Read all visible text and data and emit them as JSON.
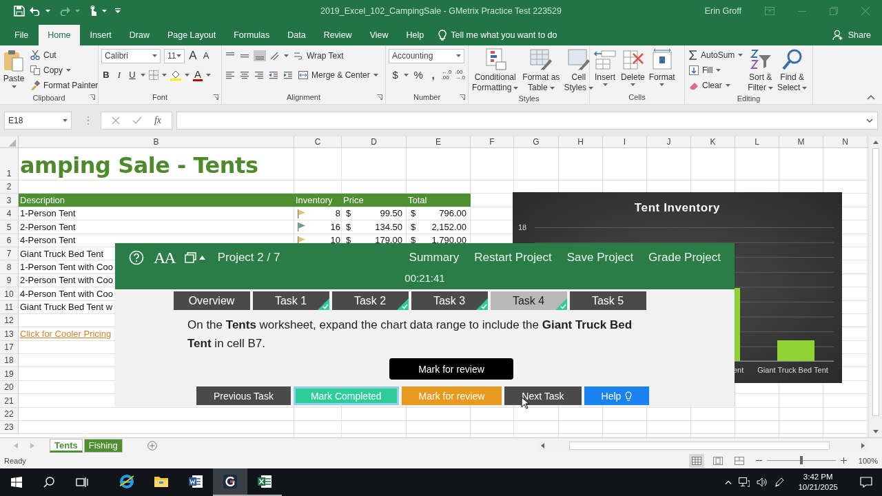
{
  "title_bar": {
    "title": "2019_Excel_102_CampingSale  -  GMetrix Practice Test 223529",
    "user": "Erin Groff"
  },
  "ribbon_tabs": [
    {
      "label": "File",
      "selected": false
    },
    {
      "label": "Home",
      "selected": true
    },
    {
      "label": "Insert",
      "selected": false
    },
    {
      "label": "Draw",
      "selected": false
    },
    {
      "label": "Page Layout",
      "selected": false
    },
    {
      "label": "Formulas",
      "selected": false
    },
    {
      "label": "Data",
      "selected": false
    },
    {
      "label": "Review",
      "selected": false
    },
    {
      "label": "View",
      "selected": false
    },
    {
      "label": "Help",
      "selected": false
    }
  ],
  "tell_me": "Tell me what you want to do",
  "share": "Share",
  "ribbon": {
    "clipboard": {
      "label": "Clipboard",
      "paste": "Paste",
      "cut": "Cut",
      "copy": "Copy",
      "format_painter": "Format Painter"
    },
    "font": {
      "label": "Font",
      "font_name": "Calibri",
      "font_size": "11",
      "grow": "A",
      "shrink": "A",
      "bold": "B",
      "italic": "I",
      "underline": "U",
      "font_color": "A"
    },
    "alignment": {
      "label": "Alignment",
      "wrap_text": "Wrap Text",
      "merge_center": "Merge & Center"
    },
    "number": {
      "label": "Number",
      "format": "Accounting",
      "currency": "$",
      "percent": "%",
      "comma": ",",
      "increase_decimal": "←.0\n.00",
      "decrease_decimal": ".00\n→.0"
    },
    "styles": {
      "label": "Styles",
      "buttons": [
        "Conditional\nFormatting",
        "Format as\nTable",
        "Cell\nStyles"
      ]
    },
    "cells": {
      "label": "Cells",
      "buttons": [
        "Insert",
        "Delete",
        "Format"
      ]
    },
    "editing": {
      "label": "Editing",
      "autosum": "AutoSum",
      "fill": "Fill",
      "clear": "Clear",
      "sort_filter": "Sort &\nFilter",
      "find_select": "Find &\nSelect"
    }
  },
  "formula_bar": {
    "name_box": "E18",
    "function_label": "fx"
  },
  "sheet": {
    "columns": [
      "B",
      "C",
      "D",
      "E",
      "F",
      "G",
      "H",
      "I",
      "J",
      "K",
      "L",
      "M",
      "N"
    ],
    "rows": [
      {
        "number": "1",
        "kind": "title",
        "description": "amping Sale - Tents"
      },
      {
        "number": "2",
        "kind": "empty"
      },
      {
        "number": "3",
        "kind": "header",
        "labels": [
          "Description",
          "Inventory",
          "Price",
          "Total"
        ]
      },
      {
        "number": "4",
        "kind": "item",
        "description": "1-Person Tent",
        "color": "#e3c069",
        "inventory": "8",
        "price_currency": "$",
        "price": "99.50",
        "total_currency": "$",
        "total": "796.00"
      },
      {
        "number": "5",
        "kind": "item",
        "description": "2-Person Tent",
        "color": "#5f9e8f",
        "inventory": "16",
        "price_currency": "$",
        "price": "134.50",
        "total_currency": "$",
        "total": "2,152.00"
      },
      {
        "number": "6",
        "kind": "item",
        "description": "4-Person Tent",
        "color": "#e3c069",
        "inventory": "10",
        "price_currency": "$",
        "price": "179.00",
        "total_currency": "$",
        "total": "1,790.00"
      },
      {
        "number": "7",
        "kind": "item",
        "description": "Giant Truck Bed Tent"
      },
      {
        "number": "8",
        "kind": "item",
        "description": "1-Person Tent with Coo"
      },
      {
        "number": "9",
        "kind": "item",
        "description": "2-Person Tent with Coo"
      },
      {
        "number": "10",
        "kind": "item",
        "description": "4-Person Tent with Coo"
      },
      {
        "number": "11",
        "kind": "item",
        "description": "Giant Truck Bed Tent w"
      },
      {
        "number": "12",
        "kind": "empty"
      },
      {
        "number": "13",
        "kind": "link",
        "description": "Click for Cooler Pricing"
      },
      {
        "number": "17",
        "kind": "empty"
      },
      {
        "number": "18",
        "kind": "empty"
      },
      {
        "number": "19",
        "kind": "empty"
      },
      {
        "number": "20",
        "kind": "empty"
      },
      {
        "number": "21",
        "kind": "empty"
      },
      {
        "number": "22",
        "kind": "empty"
      },
      {
        "number": "23",
        "kind": "empty"
      }
    ]
  },
  "chart": {
    "title": "Tent Inventory",
    "y_tick_labels": [
      "18"
    ],
    "category_labels": [
      "ent",
      "Giant Truck Bed Tent"
    ]
  },
  "task_panel": {
    "text_size": "AA",
    "project": "Project 2 / 7",
    "links": [
      "Summary",
      "Restart Project",
      "Save Project",
      "Grade Project"
    ],
    "timer": "00:21:41",
    "tabs": [
      {
        "label": "Overview",
        "selected": false,
        "completed": false
      },
      {
        "label": "Task 1",
        "selected": false,
        "completed": true
      },
      {
        "label": "Task 2",
        "selected": false,
        "completed": true
      },
      {
        "label": "Task 3",
        "selected": false,
        "completed": true
      },
      {
        "label": "Task 4",
        "selected": true,
        "completed": true
      },
      {
        "label": "Task 5",
        "selected": false,
        "completed": false
      }
    ],
    "instruction": "On the **Tents** worksheet, expand the chart data range to include the **Giant Truck Bed Tent** in cell B7.",
    "review_button": "Mark for review",
    "buttons": [
      {
        "label": "Previous Task",
        "kind": "plain",
        "color": "#4a4a4a",
        "focused": false
      },
      {
        "label": "Mark Completed",
        "kind": "plain",
        "color": "#2ecc9a",
        "focused": true
      },
      {
        "label": "Mark for review",
        "kind": "plain",
        "color": "#e89a1e",
        "focused": false
      },
      {
        "label": "Next Task",
        "kind": "plain",
        "color": "#4a4a4a",
        "focused": false
      },
      {
        "label": "Help",
        "kind": "help",
        "color": "#1a82f0",
        "focused": false
      }
    ]
  },
  "sheet_tabs": [
    {
      "label": "Tents",
      "selected": true,
      "color": "#4e8f32"
    },
    {
      "label": "Fishing",
      "selected": false,
      "color": "#4e8f32"
    }
  ],
  "status_bar": {
    "status": "Ready",
    "zoom": {
      "level": 0.5,
      "reading": "100%"
    }
  },
  "taskbar": {
    "apps": [
      {
        "kind": "browser",
        "running": false,
        "selected": false
      },
      {
        "kind": "folder",
        "running": false,
        "selected": false
      },
      {
        "kind": "word",
        "running": false,
        "selected": false
      },
      {
        "kind": "gmetrix",
        "running": true,
        "selected": true
      },
      {
        "kind": "excel",
        "running": true,
        "selected": false
      }
    ],
    "time": "3:42 PM",
    "date": "10/21/2025"
  }
}
